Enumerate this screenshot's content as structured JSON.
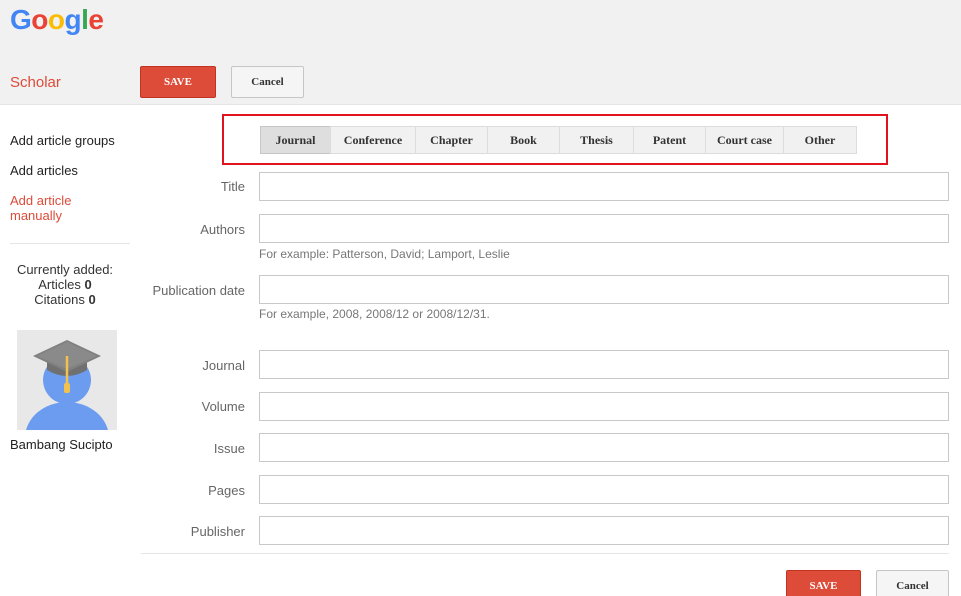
{
  "brand": {
    "letters": [
      {
        "ch": "G",
        "color": "#4285F4"
      },
      {
        "ch": "o",
        "color": "#EA4335"
      },
      {
        "ch": "o",
        "color": "#FBBC05"
      },
      {
        "ch": "g",
        "color": "#4285F4"
      },
      {
        "ch": "l",
        "color": "#34A853"
      },
      {
        "ch": "e",
        "color": "#EA4335"
      }
    ],
    "product": "Scholar"
  },
  "toolbar": {
    "save_label": "SAVE",
    "cancel_label": "Cancel"
  },
  "sidebar": {
    "items": [
      {
        "label": "Add article groups"
      },
      {
        "label": "Add articles"
      },
      {
        "label": "Add article manually"
      }
    ],
    "currently_added_label": "Currently added:",
    "articles_label": "Articles",
    "articles_count": "0",
    "citations_label": "Citations",
    "citations_count": "0",
    "user_name": "Bambang Sucipto"
  },
  "type_tabs": [
    "Journal",
    "Conference",
    "Chapter",
    "Book",
    "Thesis",
    "Patent",
    "Court case",
    "Other"
  ],
  "selected_type": "Journal",
  "form": {
    "title_label": "Title",
    "authors_label": "Authors",
    "authors_hint": "For example: Patterson, David; Lamport, Leslie",
    "date_label": "Publication date",
    "date_hint": "For example, 2008, 2008/12 or 2008/12/31.",
    "journal_label": "Journal",
    "volume_label": "Volume",
    "issue_label": "Issue",
    "pages_label": "Pages",
    "publisher_label": "Publisher",
    "title_value": "",
    "authors_value": "",
    "date_value": "",
    "journal_value": "",
    "volume_value": "",
    "issue_value": "",
    "pages_value": "",
    "publisher_value": ""
  },
  "footer": {
    "save_label": "SAVE",
    "cancel_label": "Cancel"
  },
  "colors": {
    "accent": "#dd4b39",
    "highlight_box": "#e1131f",
    "avatar_body": "#6b9cf0",
    "cap": "#707070",
    "tassel": "#f2c14e"
  }
}
